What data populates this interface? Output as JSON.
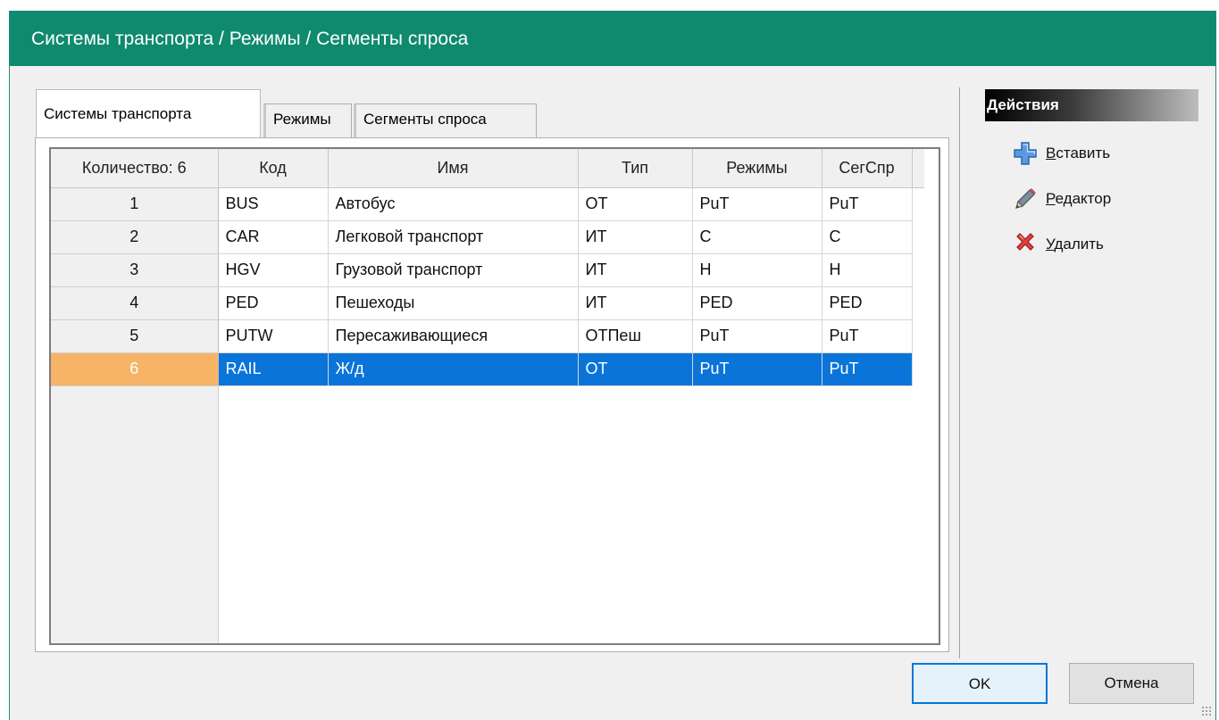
{
  "window": {
    "title": "Системы транспорта / Режимы / Сегменты спроса"
  },
  "tabs": [
    {
      "label": "Системы транспорта",
      "active": true
    },
    {
      "label": "Режимы",
      "active": false
    },
    {
      "label": "Сегменты спроса",
      "active": false
    }
  ],
  "grid": {
    "count_header": "Количество: 6",
    "columns": [
      "Код",
      "Имя",
      "Тип",
      "Режимы",
      "СегСпр"
    ],
    "rows": [
      {
        "num": "1",
        "code": "BUS",
        "name": "Автобус",
        "type": "ОТ",
        "modes": "PuT",
        "dseg": "PuT",
        "selected": false
      },
      {
        "num": "2",
        "code": "CAR",
        "name": "Легковой транспорт",
        "type": "ИТ",
        "modes": "C",
        "dseg": "C",
        "selected": false
      },
      {
        "num": "3",
        "code": "HGV",
        "name": "Грузовой транспорт",
        "type": "ИТ",
        "modes": "H",
        "dseg": "H",
        "selected": false
      },
      {
        "num": "4",
        "code": "PED",
        "name": "Пешеходы",
        "type": "ИТ",
        "modes": "PED",
        "dseg": "PED",
        "selected": false
      },
      {
        "num": "5",
        "code": "PUTW",
        "name": "Пересаживающиеся",
        "type": "ОТПеш",
        "modes": "PuT",
        "dseg": "PuT",
        "selected": false
      },
      {
        "num": "6",
        "code": "RAIL",
        "name": "Ж/д",
        "type": "ОТ",
        "modes": "PuT",
        "dseg": "PuT",
        "selected": true
      }
    ]
  },
  "actions": {
    "header": "Действия",
    "items": [
      {
        "label": "Вставить",
        "underline": "В",
        "rest": "ставить",
        "icon": "plus-icon"
      },
      {
        "label": "Редактор",
        "underline": "Р",
        "rest": "едактор",
        "icon": "pencil-icon"
      },
      {
        "label": "Удалить",
        "underline": "У",
        "rest": "далить",
        "icon": "delete-icon"
      }
    ]
  },
  "buttons": {
    "ok": "OK",
    "cancel": "Отмена"
  },
  "colors": {
    "titlebar": "#0f8a6e",
    "selection": "#0a74d9",
    "selected_rowheader": "#f7b466"
  }
}
